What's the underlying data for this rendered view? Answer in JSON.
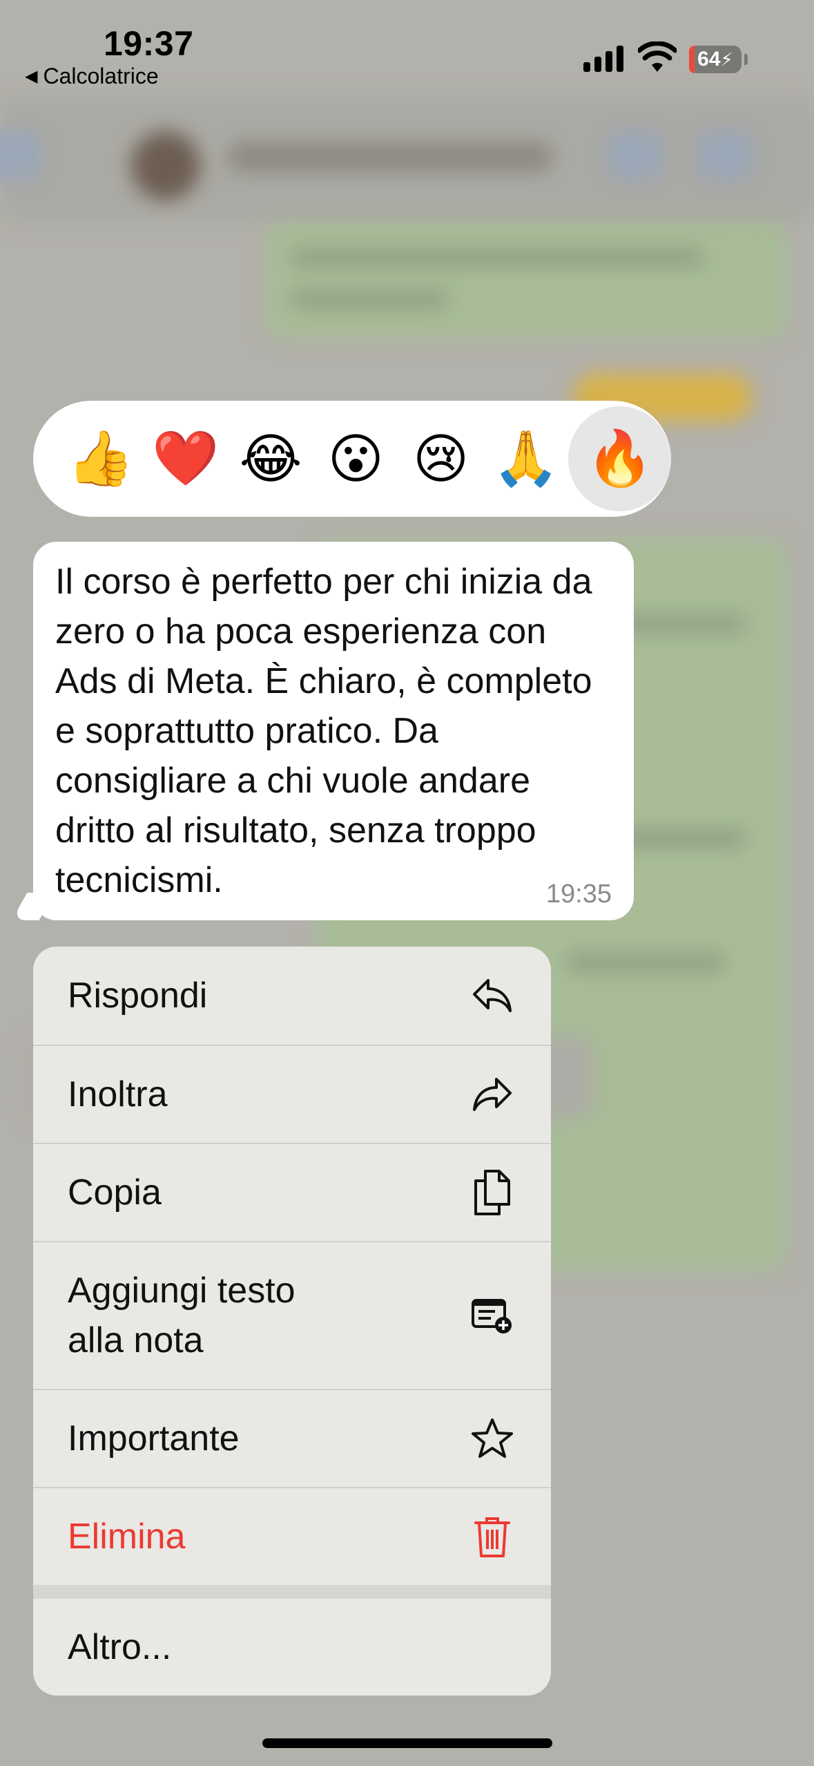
{
  "status_bar": {
    "time": "19:37",
    "back_app": "Calcolatrice",
    "battery": "64"
  },
  "reactions": [
    {
      "emoji": "👍",
      "name": "thumbs-up"
    },
    {
      "emoji": "❤️",
      "name": "heart"
    },
    {
      "emoji": "😂",
      "name": "laughing"
    },
    {
      "emoji": "😮",
      "name": "surprised"
    },
    {
      "emoji": "😢",
      "name": "crying"
    },
    {
      "emoji": "🙏",
      "name": "praying-hands"
    },
    {
      "emoji": "🔥",
      "name": "fire"
    }
  ],
  "message": {
    "text": "Il corso è perfetto per chi inizia da zero o ha poca esperienza con Ads di Meta. È chiaro, è completo e soprattutto pratico. Da consigliare a chi vuole andare dritto al risultato, senza troppo tecnicismi.",
    "time": "19:35"
  },
  "menu": {
    "reply": "Rispondi",
    "forward": "Inoltra",
    "copy": "Copia",
    "add_note_line1": "Aggiungi testo",
    "add_note_line2": "alla nota",
    "star": "Importante",
    "delete": "Elimina",
    "more": "Altro..."
  },
  "colors": {
    "danger": "#eb3a31",
    "menu_bg": "#e9e8e4",
    "bubble_bg": "#ffffff"
  }
}
